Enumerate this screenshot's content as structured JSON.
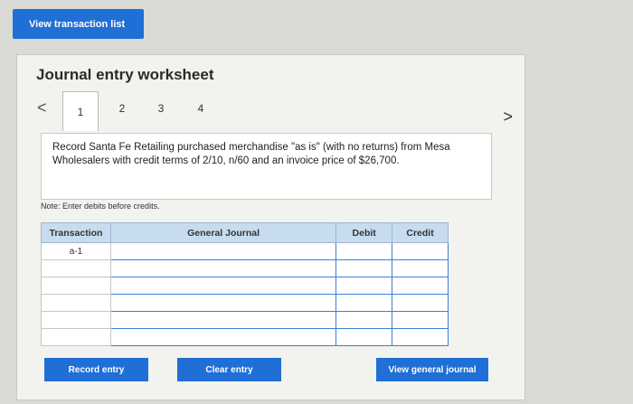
{
  "top_button": {
    "label": "View transaction list"
  },
  "worksheet": {
    "title": "Journal entry worksheet",
    "tabs": [
      "1",
      "2",
      "3",
      "4"
    ],
    "active_tab": "1",
    "prev_arrow": "<",
    "next_arrow": ">",
    "question": "Record Santa Fe Retailing purchased merchandise \"as is\" (with no returns) from Mesa Wholesalers with credit terms of 2/10, n/60 and an invoice price of $26,700.",
    "note": "Note: Enter debits before credits."
  },
  "table": {
    "headers": {
      "transaction": "Transaction",
      "general_journal": "General Journal",
      "debit": "Debit",
      "credit": "Credit"
    },
    "rows": [
      {
        "transaction": "a-1",
        "account": "",
        "debit": "",
        "credit": ""
      },
      {
        "transaction": "",
        "account": "",
        "debit": "",
        "credit": ""
      },
      {
        "transaction": "",
        "account": "",
        "debit": "",
        "credit": ""
      },
      {
        "transaction": "",
        "account": "",
        "debit": "",
        "credit": ""
      },
      {
        "transaction": "",
        "account": "",
        "debit": "",
        "credit": ""
      },
      {
        "transaction": "",
        "account": "",
        "debit": "",
        "credit": ""
      }
    ]
  },
  "buttons": {
    "record": "Record entry",
    "clear": "Clear entry",
    "view_general": "View general journal"
  },
  "colors": {
    "accent": "#1f6fd6",
    "header_bg": "#c8dcef",
    "input_border": "#3b80d3"
  }
}
